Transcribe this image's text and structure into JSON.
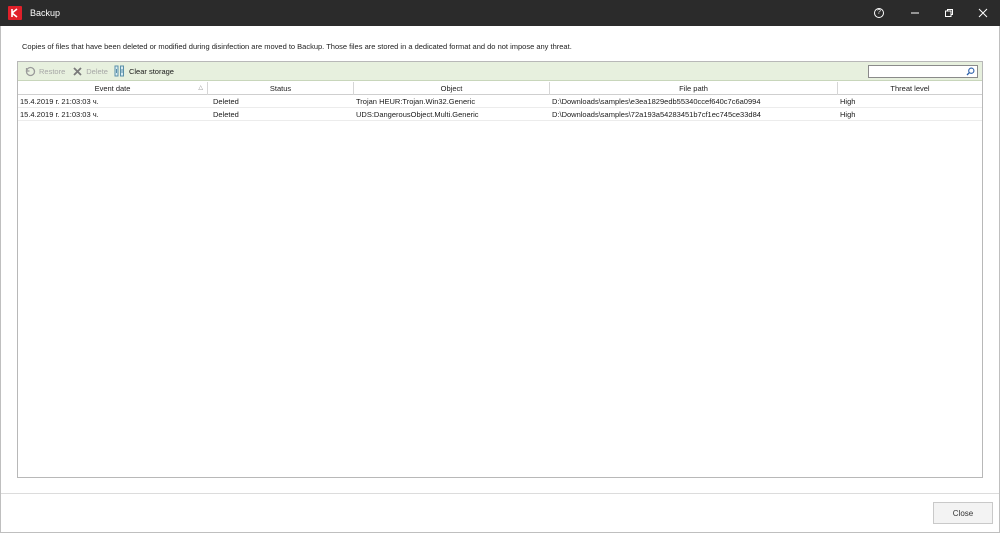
{
  "window": {
    "title": "Backup",
    "controls": {
      "help": "?"
    }
  },
  "info": "Copies of files that have been deleted or modified during disinfection are moved to Backup. Those files are stored in a dedicated format and do not impose any threat.",
  "toolbar": {
    "restore_label": "Restore",
    "delete_label": "Delete",
    "clear_label": "Clear storage",
    "search": {
      "value": "",
      "placeholder": ""
    }
  },
  "table": {
    "columns": [
      "Event date",
      "Status",
      "Object",
      "File path",
      "Threat level"
    ],
    "sort_indicator": "△",
    "rows": [
      {
        "date": "15.4.2019 г. 21:03:03 ч.",
        "status": "Deleted",
        "object": "Trojan HEUR:Trojan.Win32.Generic",
        "path": "D:\\Downloads\\samples\\e3ea1829edb55340ccef640c7c6a0994",
        "level": "High"
      },
      {
        "date": "15.4.2019 г. 21:03:03 ч.",
        "status": "Deleted",
        "object": "UDS:DangerousObject.Multi.Generic",
        "path": "D:\\Downloads\\samples\\72a193a54283451b7cf1ec745ce33d84",
        "level": "High"
      }
    ]
  },
  "footer": {
    "close_label": "Close"
  },
  "colors": {
    "titlebar": "#2b2b2b",
    "toolbar": "#e7f0de",
    "brand": "#e0202a"
  }
}
